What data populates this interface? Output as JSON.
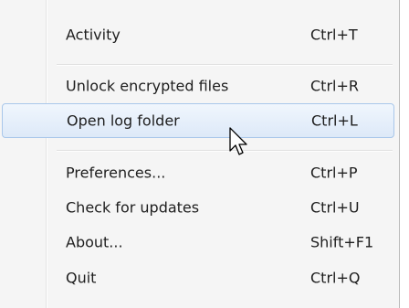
{
  "menu": {
    "items": [
      {
        "label": "Activity",
        "shortcut": "Ctrl+T"
      },
      {
        "label": "Unlock encrypted files",
        "shortcut": "Ctrl+R"
      },
      {
        "label": "Open log folder",
        "shortcut": "Ctrl+L",
        "highlighted": true
      },
      {
        "label": "Preferences...",
        "shortcut": "Ctrl+P"
      },
      {
        "label": "Check for updates",
        "shortcut": "Ctrl+U"
      },
      {
        "label": "About...",
        "shortcut": "Shift+F1"
      },
      {
        "label": "Quit",
        "shortcut": "Ctrl+Q"
      }
    ]
  },
  "cursor": {
    "icon": "arrow-pointer-icon"
  },
  "colors": {
    "menu_background": "#f5f5f5",
    "highlight_border": "#a9c7ea",
    "highlight_fill": "#dde9f8",
    "text": "#1e1e1e"
  }
}
